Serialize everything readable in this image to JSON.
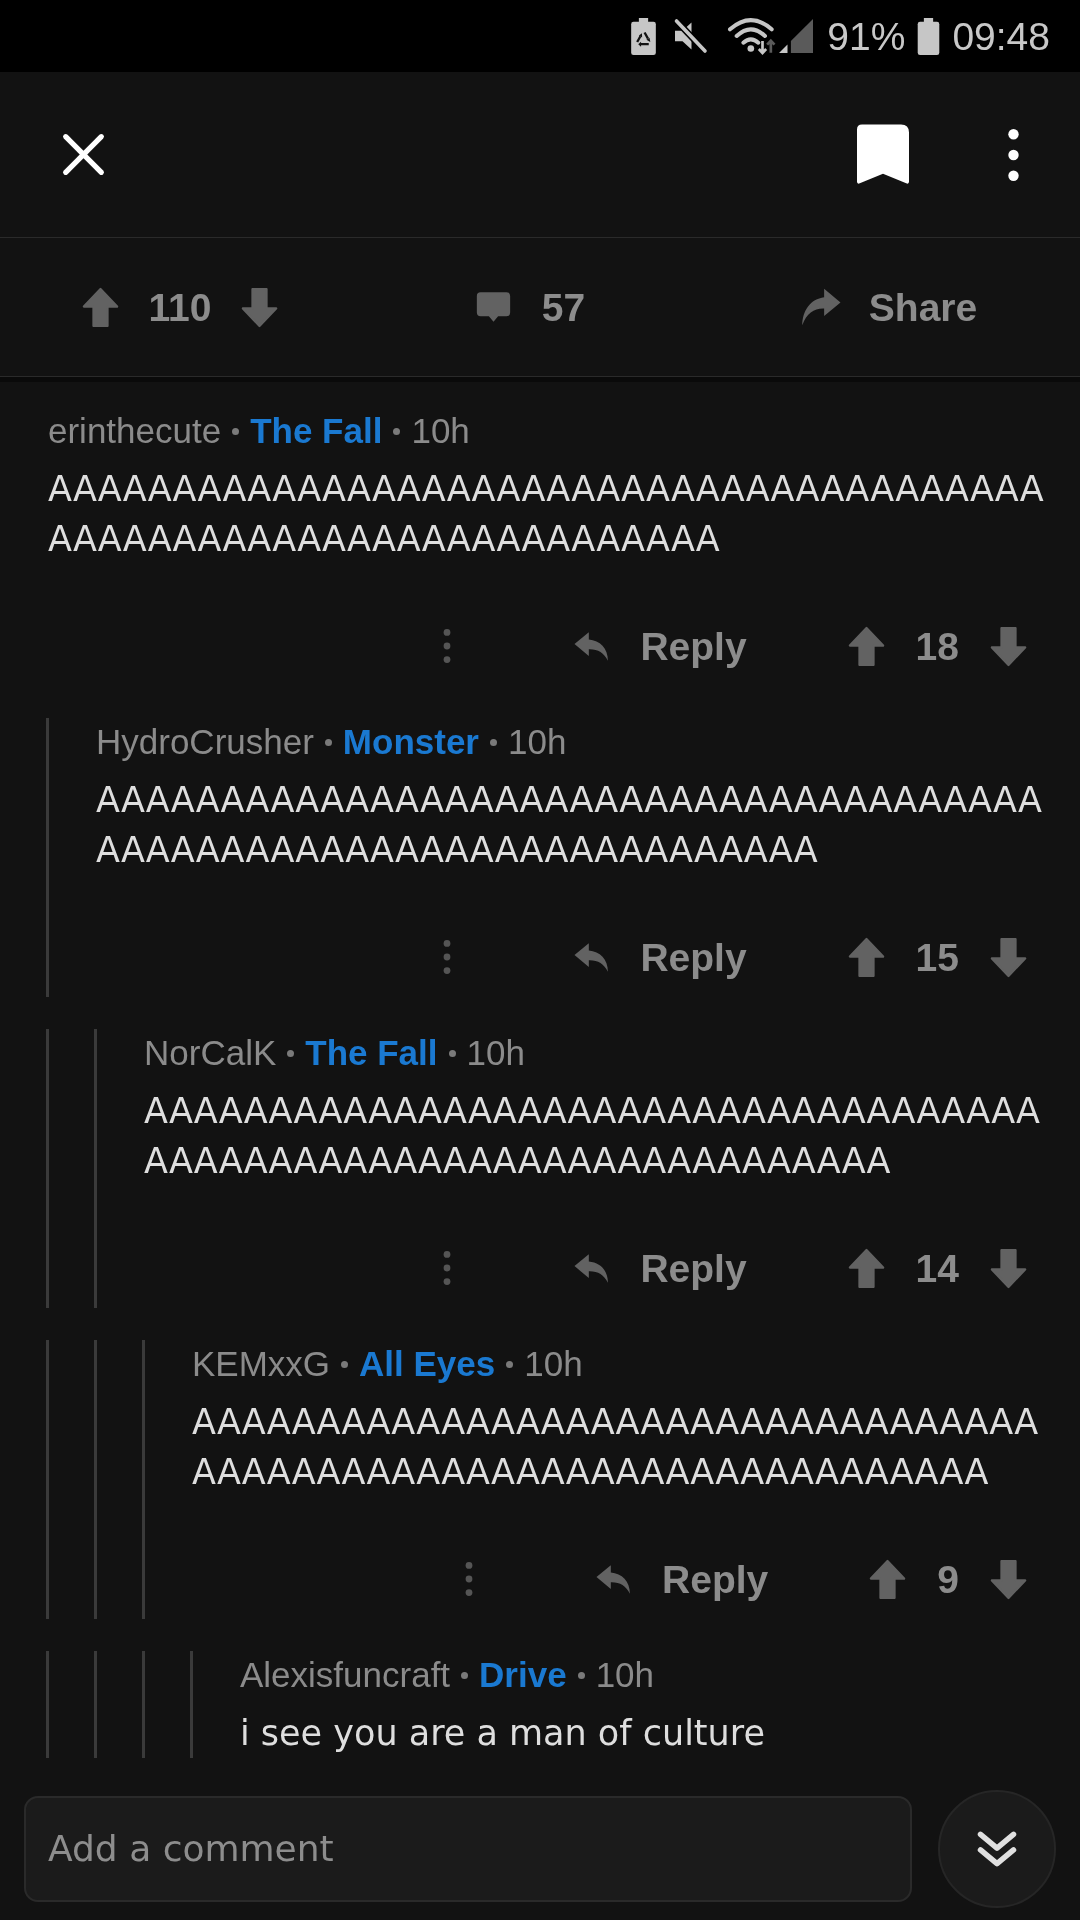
{
  "status_bar": {
    "battery": "91%",
    "time": "09:48"
  },
  "post_actions": {
    "score": "110",
    "comment_count": "57",
    "share_label": "Share"
  },
  "comments": [
    {
      "author": "erinthecute",
      "flair": "The Fall",
      "time": "10h",
      "body": "AAAAAAAAAAAAAAAAAAAAAAAAAAAAAAAAAAAAAAAAAAAAAAAAAAAAAAAAAAAAAAAAAAA",
      "reply_label": "Reply",
      "score": "18",
      "children": [
        {
          "author": "HydroCrusher",
          "flair": "Monster",
          "time": "10h",
          "body": "AAAAAAAAAAAAAAAAAAAAAAAAAAAAAAAAAAAAAAAAAAAAAAAAAAAAAAAAAAAAAAAAAAA",
          "reply_label": "Reply",
          "score": "15",
          "children": [
            {
              "author": "NorCalK",
              "flair": "The Fall",
              "time": "10h",
              "body": "AAAAAAAAAAAAAAAAAAAAAAAAAAAAAAAAAAAAAAAAAAAAAAAAAAAAAAAAAAAAAAAAAA",
              "reply_label": "Reply",
              "score": "14",
              "children": [
                {
                  "author": "KEMxxG",
                  "flair": "All Eyes",
                  "time": "10h",
                  "body": "AAAAAAAAAAAAAAAAAAAAAAAAAAAAAAAAAAAAAAAAAAAAAAAAAAAAAAAAAAAAAAAAAA",
                  "reply_label": "Reply",
                  "score": "9",
                  "children": [
                    {
                      "author": "Alexisfuncraft",
                      "flair": "Drive",
                      "time": "10h",
                      "body": "i see you are a man of culture"
                    }
                  ]
                }
              ]
            }
          ]
        }
      ]
    }
  ],
  "comment_box": {
    "placeholder": "Add a comment"
  }
}
